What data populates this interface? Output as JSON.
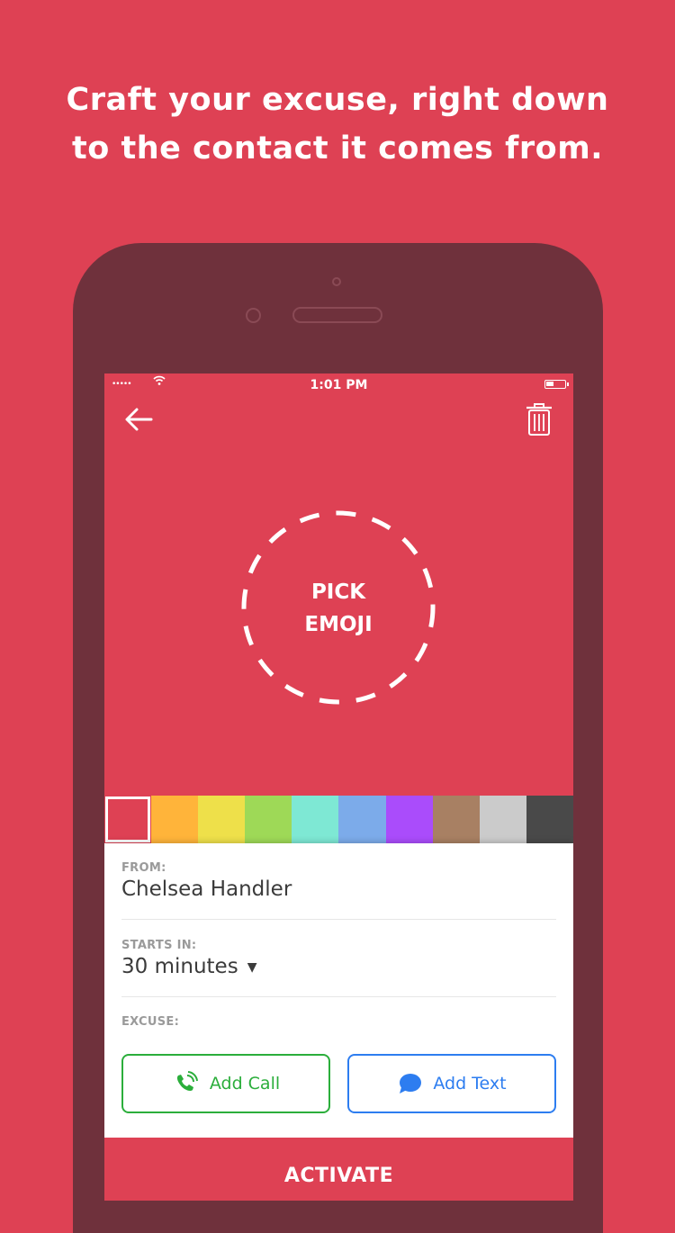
{
  "headline": {
    "line1": "Craft your excuse, right down",
    "line2": "to the contact it comes from."
  },
  "statusbar": {
    "signal": "•••••",
    "time": "1:01 PM"
  },
  "toolbar": {
    "back_icon": "arrow-left-icon",
    "trash_icon": "trash-icon"
  },
  "emoji_picker": {
    "line1": "PICK",
    "line2": "EMOJI"
  },
  "swatches": [
    {
      "color": "#DE4154",
      "selected": true
    },
    {
      "color": "#FFB43A",
      "selected": false
    },
    {
      "color": "#EEE04A",
      "selected": false
    },
    {
      "color": "#9ED957",
      "selected": false
    },
    {
      "color": "#7EE8D4",
      "selected": false
    },
    {
      "color": "#7CABEA",
      "selected": false
    },
    {
      "color": "#AA4CFB",
      "selected": false
    },
    {
      "color": "#A88063",
      "selected": false
    },
    {
      "color": "#CBCBCB",
      "selected": false
    },
    {
      "color": "#494949",
      "selected": false
    }
  ],
  "form": {
    "from_label": "FROM:",
    "from_value": "Chelsea Handler",
    "starts_label": "STARTS IN:",
    "starts_value": "30 minutes",
    "excuse_label": "EXCUSE:"
  },
  "buttons": {
    "add_call": "Add Call",
    "add_text": "Add Text"
  },
  "activate": "ACTIVATE",
  "colors": {
    "brand": "#DE4154",
    "phone_body": "#6F313C",
    "call_green": "#2BAE3B",
    "text_blue": "#2D7DF0"
  }
}
